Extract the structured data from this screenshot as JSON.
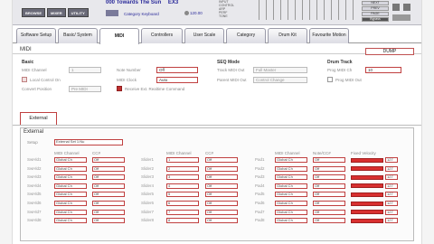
{
  "header": {
    "logo_buttons": [
      "BROWSE",
      "MIXER",
      "UTILITY"
    ],
    "song_title": "000 Towards The Sun",
    "song_suffix": "EX3",
    "category_label": "Category Keyboard",
    "bpm": "120.00",
    "mode_list": [
      "INPUT",
      "CONTROL",
      "ARP",
      "PERF",
      "TONE"
    ],
    "right_buttons": [
      "NEXT",
      "PREV",
      "PAGE",
      "Bypass"
    ]
  },
  "tabs": [
    {
      "label": "Software Setup"
    },
    {
      "label": "Basic/ System"
    },
    {
      "label": "MIDI"
    },
    {
      "label": "Controllers"
    },
    {
      "label": "User Scale"
    },
    {
      "label": "Category"
    },
    {
      "label": "Drum Kit"
    },
    {
      "label": "Favourite Motion"
    }
  ],
  "midi": {
    "title": "MIDI",
    "dump_label": "DUMP",
    "basic": {
      "title": "Basic",
      "midi_channel_label": "MIDI Channel",
      "midi_channel_value": "1",
      "local_control_label": "Local Control On",
      "convert_position_label": "Convert Position",
      "convert_position_value": "Pre MIDI",
      "note_number_label": "Note Number",
      "note_number_value": "Off",
      "midi_clock_label": "MIDI Clock",
      "midi_clock_value": "Auto",
      "realtime_label": "Receive Ext. Realtime Command"
    },
    "seq_mode": {
      "title": "SEQ Mode",
      "track_midi_out_label": "Track MIDI Out",
      "track_midi_out_value": "Full Master",
      "parent_midi_out_label": "Parent MIDI Out",
      "parent_midi_out_value": "Control Change"
    },
    "drum_track": {
      "title": "Drum Track",
      "prog_midi_ch_label": "Prog MIDI Ch",
      "prog_midi_ch_value": "10",
      "prog_midi_out_label": "Prog MIDI Out"
    }
  },
  "external": {
    "tab_label": "External",
    "title": "External",
    "setup_label": "Setup",
    "setup_value": "External Set 1:Nu",
    "switch_col": {
      "ch_header": "MIDI Channel",
      "cc_header": "CC#"
    },
    "slider_col": {
      "ch_header": "MIDI Channel",
      "cc_header": "CC#"
    },
    "pad_col": {
      "ch_header": "MIDI Channel",
      "note_header": "Note/CC#",
      "vel_header": "Fixed Velocity"
    },
    "rows": [
      {
        "sw": "SwHld1",
        "sl": "Slider1",
        "pad": "Pad1",
        "ch": "Global Ch",
        "slch": "1",
        "cc": "Off",
        "slcc": "Off",
        "pch": "Global Ch",
        "pnote": "Off",
        "vel": 1.0,
        "vel_val": "127"
      },
      {
        "sw": "SwHld2",
        "sl": "Slider2",
        "pad": "Pad2",
        "ch": "Global Ch",
        "slch": "2",
        "cc": "Off",
        "slcc": "Off",
        "pch": "Global Ch",
        "pnote": "Off",
        "vel": 1.0,
        "vel_val": "127"
      },
      {
        "sw": "SwHld3",
        "sl": "Slider3",
        "pad": "Pad3",
        "ch": "Global Ch",
        "slch": "3",
        "cc": "Off",
        "slcc": "Off",
        "pch": "Global Ch",
        "pnote": "Off",
        "vel": 1.0,
        "vel_val": "127"
      },
      {
        "sw": "SwHld4",
        "sl": "Slider4",
        "pad": "Pad4",
        "ch": "Global Ch",
        "slch": "4",
        "cc": "Off",
        "slcc": "Off",
        "pch": "Global Ch",
        "pnote": "Off",
        "vel": 1.0,
        "vel_val": "127"
      },
      {
        "sw": "SwHld5",
        "sl": "Slider5",
        "pad": "Pad5",
        "ch": "Global Ch",
        "slch": "5",
        "cc": "Off",
        "slcc": "Off",
        "pch": "Global Ch",
        "pnote": "Off",
        "vel": 1.0,
        "vel_val": "127"
      },
      {
        "sw": "SwHld6",
        "sl": "Slider6",
        "pad": "Pad6",
        "ch": "Global Ch",
        "slch": "6",
        "cc": "Off",
        "slcc": "Off",
        "pch": "Global Ch",
        "pnote": "Off",
        "vel": 1.0,
        "vel_val": "127"
      },
      {
        "sw": "SwHld7",
        "sl": "Slider7",
        "pad": "Pad7",
        "ch": "Global Ch",
        "slch": "7",
        "cc": "Off",
        "slcc": "Off",
        "pch": "Global Ch",
        "pnote": "Off",
        "vel": 1.0,
        "vel_val": "127"
      },
      {
        "sw": "SwHld8",
        "sl": "Slider8",
        "pad": "Pad8",
        "ch": "Global Ch",
        "slch": "8",
        "cc": "Off",
        "slcc": "Off",
        "pch": "Global Ch",
        "pnote": "Off",
        "vel": 1.0,
        "vel_val": "127"
      }
    ]
  },
  "colors": {
    "accent": "#c04040",
    "bar": "#d83030"
  }
}
